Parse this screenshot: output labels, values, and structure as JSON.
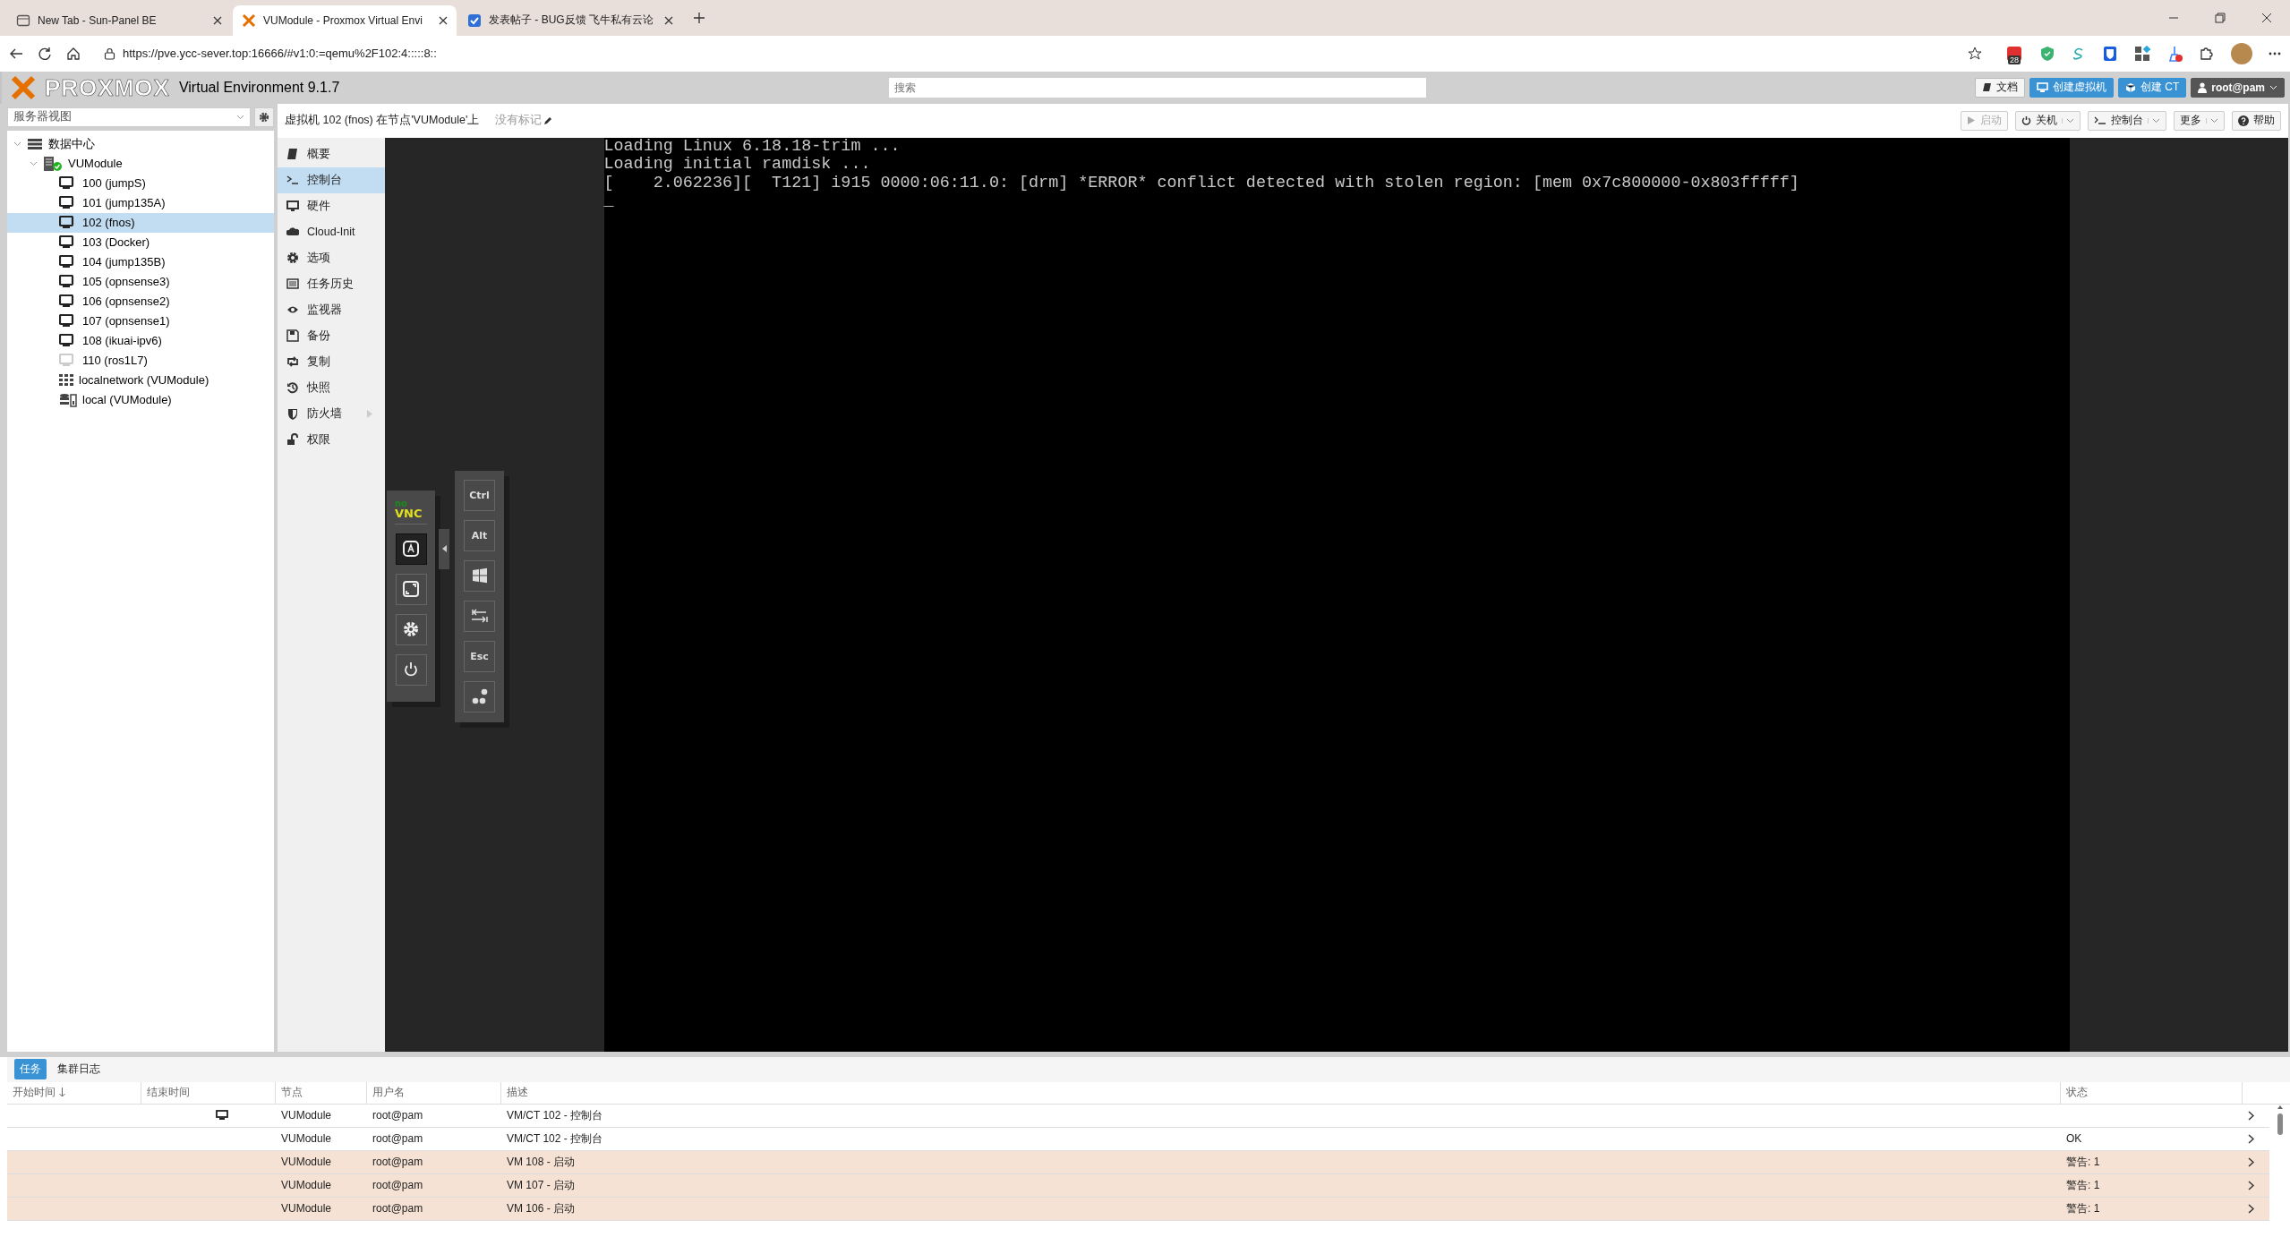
{
  "browser": {
    "tabs": [
      {
        "title": "New Tab - Sun-Panel BE",
        "kind": "newtab",
        "selected": false
      },
      {
        "title": "VUModule - Proxmox Virtual Envi",
        "kind": "proxmox",
        "selected": true
      },
      {
        "title": "发表帖子 - BUG反馈 飞牛私有云论",
        "kind": "forum",
        "selected": false
      }
    ],
    "url": "https://pve.ycc-sever.top:16666/#v1:0:=qemu%2F102:4:::::8::",
    "badge": "28"
  },
  "header": {
    "logo": "PROXMOX",
    "version": "Virtual Environment 9.1.7",
    "search": {
      "placeholder": "搜索"
    },
    "buttons": [
      {
        "label": "文档",
        "kind": "docs"
      },
      {
        "label": "创建虚拟机",
        "kind": "create-vm"
      },
      {
        "label": "创建 CT",
        "kind": "create-ct"
      },
      {
        "label": "root@pam",
        "kind": "user"
      }
    ]
  },
  "sidebar": {
    "view": "服务器视图",
    "tree": [
      {
        "label": "数据中心",
        "kind": "datacenter",
        "expanded": true,
        "selected": false,
        "children": [
          {
            "label": "VUModule",
            "kind": "node",
            "expanded": true,
            "selected": false,
            "children": [
              {
                "label": "100 (jumpS)",
                "kind": "vm",
                "running": true,
                "selected": false
              },
              {
                "label": "101 (jump135A)",
                "kind": "vm",
                "running": true,
                "selected": false
              },
              {
                "label": "102 (fnos)",
                "kind": "vm",
                "running": true,
                "selected": true
              },
              {
                "label": "103 (Docker)",
                "kind": "vm",
                "running": true,
                "selected": false
              },
              {
                "label": "104 (jump135B)",
                "kind": "vm",
                "running": true,
                "selected": false
              },
              {
                "label": "105 (opnsense3)",
                "kind": "vm",
                "running": true,
                "selected": false
              },
              {
                "label": "106 (opnsense2)",
                "kind": "vm",
                "running": true,
                "selected": false
              },
              {
                "label": "107 (opnsense1)",
                "kind": "vm",
                "running": true,
                "selected": false
              },
              {
                "label": "108 (ikuai-ipv6)",
                "kind": "vm",
                "running": true,
                "selected": false
              },
              {
                "label": "110 (ros1L7)",
                "kind": "vm",
                "running": false,
                "selected": false
              },
              {
                "label": "localnetwork (VUModule)",
                "kind": "network",
                "selected": false
              },
              {
                "label": "local (VUModule)",
                "kind": "storage",
                "selected": false
              }
            ]
          }
        ]
      }
    ]
  },
  "content": {
    "title": "虚拟机 102 (fnos) 在节点'VUModule'上",
    "tags": "没有标记",
    "toolbar": [
      {
        "label": "启动",
        "kind": "start",
        "disabled": true,
        "dropdown": false
      },
      {
        "label": "关机",
        "kind": "shutdown",
        "disabled": false,
        "dropdown": true
      },
      {
        "label": "控制台",
        "kind": "console",
        "disabled": false,
        "dropdown": true
      },
      {
        "label": "更多",
        "kind": "more",
        "disabled": false,
        "dropdown": true
      },
      {
        "label": "帮助",
        "kind": "help",
        "disabled": false,
        "dropdown": false
      }
    ],
    "nav": [
      {
        "label": "概要",
        "kind": "book",
        "selected": false
      },
      {
        "label": "控制台",
        "kind": "terminal",
        "selected": true
      },
      {
        "label": "硬件",
        "kind": "monitor",
        "selected": false
      },
      {
        "label": "Cloud-Init",
        "kind": "cloud",
        "selected": false
      },
      {
        "label": "选项",
        "kind": "gear",
        "selected": false
      },
      {
        "label": "任务历史",
        "kind": "list",
        "selected": false
      },
      {
        "label": "监视器",
        "kind": "eye",
        "selected": false
      },
      {
        "label": "备份",
        "kind": "save",
        "selected": false
      },
      {
        "label": "复制",
        "kind": "retweet",
        "selected": false
      },
      {
        "label": "快照",
        "kind": "history",
        "selected": false
      },
      {
        "label": "防火墙",
        "kind": "shield",
        "selected": false,
        "submenu": true
      },
      {
        "label": "权限",
        "kind": "unlock",
        "selected": false
      }
    ],
    "console": {
      "lines": [
        "Loading Linux 6.18.18-trim ...",
        "Loading initial ramdisk ...",
        "[    2.062236][  T121] i915 0000:06:11.0: [drm] *ERROR* conflict detected with stolen region: [mem 0x7c800000-0x803fffff]"
      ],
      "cursor": "_"
    },
    "novnc": {
      "logo_top": "no",
      "logo_bottom": "VNC",
      "controls": [
        {
          "kind": "keyboard",
          "selected": true
        },
        {
          "kind": "fullscreen",
          "selected": false
        },
        {
          "kind": "settings",
          "selected": false
        },
        {
          "kind": "power",
          "selected": false
        }
      ],
      "keys": [
        {
          "kind": "text",
          "label": "Ctrl"
        },
        {
          "kind": "text",
          "label": "Alt"
        },
        {
          "kind": "windows"
        },
        {
          "kind": "tab"
        },
        {
          "kind": "text",
          "label": "Esc"
        },
        {
          "kind": "ctrlaltdel"
        }
      ]
    }
  },
  "bottom": {
    "tabs": [
      {
        "label": "任务",
        "selected": true
      },
      {
        "label": "集群日志",
        "selected": false
      }
    ],
    "columns": [
      {
        "label": "开始时间",
        "sorted": true
      },
      {
        "label": "结束时间",
        "sorted": false
      },
      {
        "label": "节点",
        "sorted": false
      },
      {
        "label": "用户名",
        "sorted": false
      },
      {
        "label": "描述",
        "sorted": false
      },
      {
        "label": "状态",
        "sorted": false
      }
    ],
    "rows": [
      {
        "running": true,
        "node": "VUModule",
        "user": "root@pam",
        "description": "VM/CT 102 - 控制台",
        "kind": "normal"
      },
      {
        "running": false,
        "node": "VUModule",
        "user": "root@pam",
        "description": "VM/CT 102 - 控制台",
        "status": "OK",
        "kind": "normal"
      },
      {
        "running": false,
        "node": "VUModule",
        "user": "root@pam",
        "description": "VM 108 - 启动",
        "status": "警告: 1",
        "kind": "warning"
      },
      {
        "running": false,
        "node": "VUModule",
        "user": "root@pam",
        "description": "VM 107 - 启动",
        "status": "警告: 1",
        "kind": "warning"
      },
      {
        "running": false,
        "node": "VUModule",
        "user": "root@pam",
        "description": "VM 106 - 启动",
        "status": "警告: 1",
        "kind": "warning"
      }
    ]
  }
}
